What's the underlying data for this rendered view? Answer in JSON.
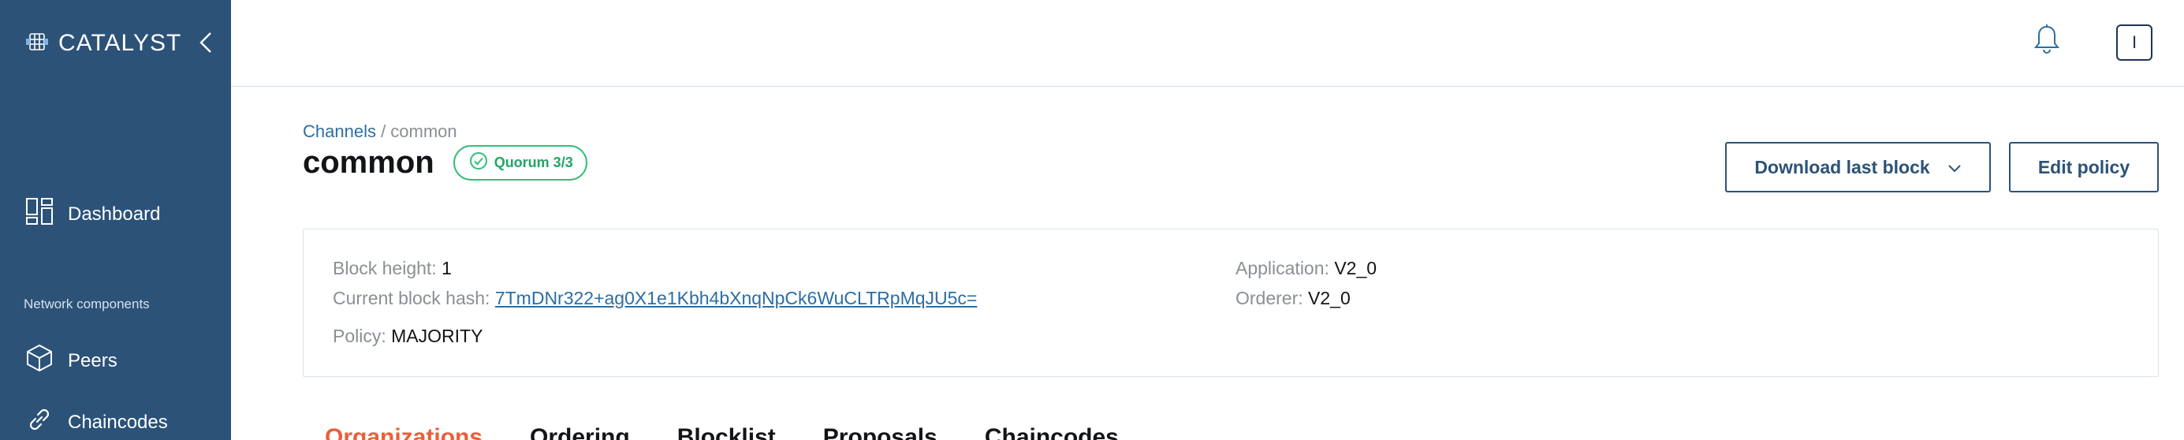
{
  "sidebar": {
    "logo_text": "CATALYST",
    "nav": {
      "dashboard": "Dashboard",
      "section_label": "Network components",
      "peers": "Peers",
      "chaincodes": "Chaincodes"
    }
  },
  "header": {
    "avatar_initial": "I"
  },
  "breadcrumb": {
    "parent": "Channels",
    "separator": " / ",
    "current": "common"
  },
  "page": {
    "title": "common",
    "badge": "Quorum 3/3"
  },
  "actions": {
    "download_label": "Download last block",
    "edit_label": "Edit policy"
  },
  "info": {
    "block_height_label": "Block height:",
    "block_height_value": "1",
    "current_hash_label": "Current block hash:",
    "current_hash_value": "7TmDNr322+ag0X1e1Kbh4bXnqNpCk6WuCLTRpMqJU5c=",
    "policy_label": "Policy:",
    "policy_value": "MAJORITY",
    "application_label": "Application:",
    "application_value": "V2_0",
    "orderer_label": "Orderer:",
    "orderer_value": "V2_0"
  },
  "tabs": [
    {
      "label": "Organizations",
      "active": true
    },
    {
      "label": "Ordering",
      "active": false
    },
    {
      "label": "Blocklist",
      "active": false
    },
    {
      "label": "Proposals",
      "active": false
    },
    {
      "label": "Chaincodes",
      "active": false
    }
  ],
  "colors": {
    "sidebar": "#2c5278",
    "link": "#2c6ea3",
    "success": "#2fbf7a",
    "active_tab": "#e8603c"
  }
}
